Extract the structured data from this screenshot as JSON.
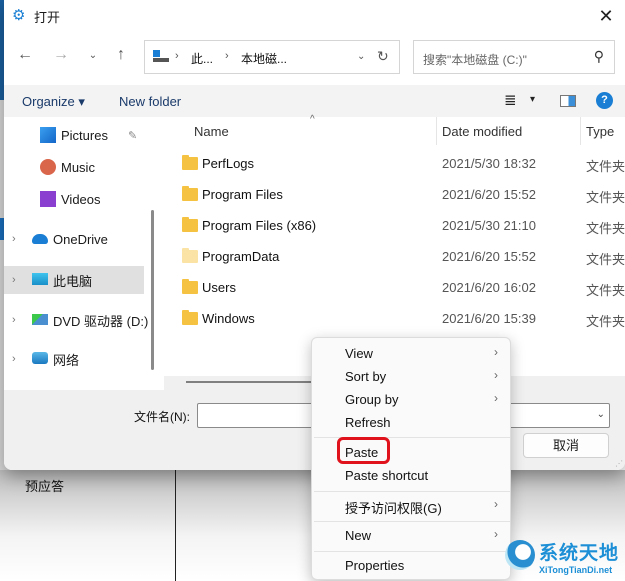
{
  "background": {
    "partial_label": "预应答"
  },
  "dialog": {
    "title": "打开",
    "title_icon": "gears-icon",
    "close_label": "✕"
  },
  "navigation": {
    "back": "←",
    "forward": "→",
    "recent": "⌄",
    "up": "↑",
    "breadcrumb": [
      "此...",
      "本地磁..."
    ],
    "breadcrumb_separator": "›",
    "address_dropdown": "⌄",
    "refresh": "↻",
    "search_placeholder": "搜索\"本地磁盘 (C:)\"",
    "search_icon": "⚲"
  },
  "command_bar": {
    "organize_label": "Organize ▾",
    "new_folder_label": "New folder",
    "view_menu_icon": "≣",
    "view_dropdown": "▾",
    "help_label": "?"
  },
  "nav_pane": {
    "items": [
      {
        "label": "Pictures",
        "icon": "pictures-icon",
        "pinned": true,
        "expandable": false,
        "selected": false
      },
      {
        "label": "Music",
        "icon": "music-icon",
        "pinned": false,
        "expandable": false,
        "selected": false
      },
      {
        "label": "Videos",
        "icon": "videos-icon",
        "pinned": false,
        "expandable": false,
        "selected": false
      },
      {
        "label": "OneDrive",
        "icon": "onedrive-icon",
        "pinned": false,
        "expandable": true,
        "selected": false
      },
      {
        "label": "此电脑",
        "icon": "this-pc-icon",
        "pinned": false,
        "expandable": true,
        "selected": true
      },
      {
        "label": "DVD 驱动器 (D:)",
        "icon": "dvd-drive-icon",
        "pinned": false,
        "expandable": true,
        "selected": false
      },
      {
        "label": "网络",
        "icon": "network-icon",
        "pinned": false,
        "expandable": true,
        "selected": false
      }
    ],
    "chevron": "›",
    "pin": "📌"
  },
  "file_list": {
    "columns": [
      "Name",
      "Date modified",
      "Type"
    ],
    "sort_indicator": "^",
    "rows": [
      {
        "name": "PerfLogs",
        "date": "2021/5/30 18:32",
        "type": "文件夹",
        "hidden": false
      },
      {
        "name": "Program Files",
        "date": "2021/6/20 15:52",
        "type": "文件夹",
        "hidden": false
      },
      {
        "name": "Program Files (x86)",
        "date": "2021/5/30 21:10",
        "type": "文件夹",
        "hidden": false
      },
      {
        "name": "ProgramData",
        "date": "2021/6/20 15:52",
        "type": "文件夹",
        "hidden": true
      },
      {
        "name": "Users",
        "date": "2021/6/20 16:02",
        "type": "文件夹",
        "hidden": false
      },
      {
        "name": "Windows",
        "date": "2021/6/20 15:39",
        "type": "文件夹",
        "hidden": false
      }
    ]
  },
  "bottom_bar": {
    "filename_label": "文件名(N):",
    "filename_value": "",
    "dropdown_icon": "⌄",
    "cancel_label": "取消"
  },
  "context_menu": {
    "items": [
      {
        "label": "View",
        "submenu": true
      },
      {
        "label": "Sort by",
        "submenu": true
      },
      {
        "label": "Group by",
        "submenu": true
      },
      {
        "label": "Refresh",
        "submenu": false
      },
      {
        "label": "Paste",
        "submenu": false,
        "highlighted": true
      },
      {
        "label": "Paste shortcut",
        "submenu": false
      },
      {
        "label": "授予访问权限(G)",
        "submenu": true
      },
      {
        "label": "New",
        "submenu": true
      },
      {
        "label": "Properties",
        "submenu": false
      }
    ],
    "submenu_arrow": "›",
    "highlight_color": "#e0121b"
  },
  "watermark": {
    "title": "系统天地",
    "subtitle": "XiTongTianDi.net"
  }
}
